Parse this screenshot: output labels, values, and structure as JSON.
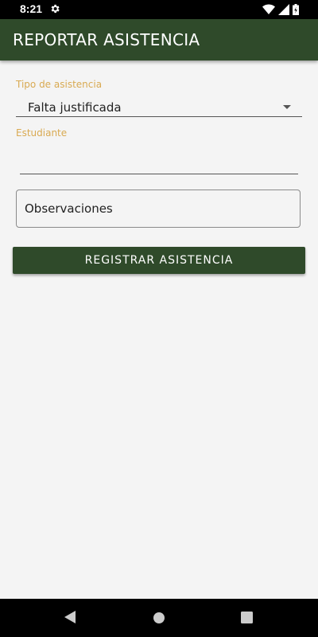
{
  "status_bar": {
    "time": "8:21",
    "icons": [
      "gear-icon",
      "wifi-icon",
      "signal-icon",
      "battery-icon"
    ]
  },
  "app_bar": {
    "title": "REPORTAR ASISTENCIA",
    "color": "#2f4a2a"
  },
  "form": {
    "tipo_label": "Tipo de asistencia",
    "tipo_value": "Falta justificada",
    "estudiante_label": "Estudiante",
    "estudiante_value": "",
    "observaciones_placeholder": "Observaciones",
    "submit_label": "REGISTRAR ASISTENCIA"
  },
  "colors": {
    "accent_label": "#d9aa52",
    "background": "#f4f4f4",
    "button": "#2f4a2a"
  },
  "nav_bar": {
    "icons": [
      "back-icon",
      "home-icon",
      "recents-icon"
    ]
  }
}
